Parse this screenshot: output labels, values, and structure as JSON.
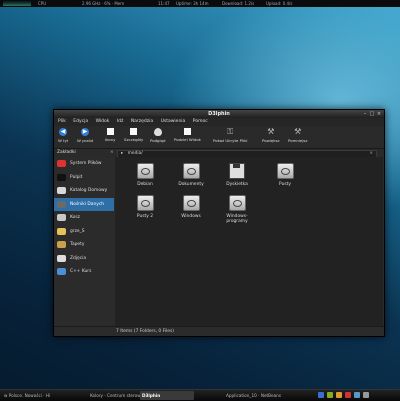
{
  "top_panel": {
    "cpu": "CPU",
    "mem": "2.96 GHz · 6% · Mem",
    "clock": "11:47",
    "uptime": "Uptime: 3h 14m",
    "download": "Download: 1.2/s",
    "upload": "Upload: 0.4/s"
  },
  "window": {
    "title": "D3lphin",
    "controls": {
      "minimize": "–",
      "maximize": "□",
      "close": "×"
    }
  },
  "menu": [
    "Plik",
    "Edycja",
    "Widok",
    "Idź",
    "Narzędzia",
    "Ustawienia",
    "Pomoc"
  ],
  "toolbar": [
    {
      "label": "W tył",
      "icon": "back-arrow-icon"
    },
    {
      "label": "W przód",
      "icon": "forward-arrow-icon"
    },
    {
      "label": "Ikony",
      "icon": "icons-view-icon"
    },
    {
      "label": "Szczegóły",
      "icon": "details-view-icon"
    },
    {
      "label": "Podgląd",
      "icon": "preview-icon"
    },
    {
      "label": "Podziel Widok",
      "icon": "split-view-icon"
    },
    {
      "label": "Pokaż Ukryte Pliki",
      "icon": "hidden-files-icon"
    },
    {
      "label": "Powiększ",
      "icon": "zoom-in-icon"
    },
    {
      "label": "Pomniejsz",
      "icon": "zoom-out-icon"
    }
  ],
  "places_header": "Zakładki",
  "location": "media/",
  "places": [
    {
      "label": "System Plików",
      "color": "#d33",
      "icon": "filesystem-icon",
      "selected": false
    },
    {
      "label": "Pulpit",
      "color": "#111",
      "icon": "desktop-icon",
      "selected": false
    },
    {
      "label": "Katalog Domowy",
      "color": "#d8d8d8",
      "icon": "home-folder-icon",
      "selected": false
    },
    {
      "label": "Nośniki Danych",
      "color": "#6a6a6a",
      "icon": "storage-media-icon",
      "selected": true
    },
    {
      "label": "Kosz",
      "color": "#c9c9c9",
      "icon": "trash-icon",
      "selected": false
    },
    {
      "label": "grze_S",
      "color": "#e6c15a",
      "icon": "star-folder-icon",
      "selected": false
    },
    {
      "label": "Tapety",
      "color": "#caa14a",
      "icon": "wallpaper-folder-icon",
      "selected": false
    },
    {
      "label": "Zdjęcia",
      "color": "#ddd",
      "icon": "photos-folder-icon",
      "selected": false
    },
    {
      "label": "C++ Kurs",
      "color": "#4a8fd8",
      "icon": "network-folder-icon",
      "selected": false
    }
  ],
  "items": [
    {
      "label": "Debian",
      "kind": "drive"
    },
    {
      "label": "Dokumenty",
      "kind": "drive"
    },
    {
      "label": "Dyskietka",
      "kind": "floppy"
    },
    {
      "label": "Pusty",
      "kind": "drive"
    },
    {
      "label": "Pusty 2",
      "kind": "drive"
    },
    {
      "label": "Windows",
      "kind": "drive"
    },
    {
      "label": "Windows-programy",
      "kind": "drive"
    }
  ],
  "status": "7 Items (7 Folders, 0 Files)",
  "taskbar": {
    "tasks": [
      {
        "label": "w Polsce. Nowości · Hi",
        "active": false
      },
      {
        "label": "Kolory · Centrum sterowa",
        "active": false
      },
      {
        "label": "D3lphin",
        "active": true
      },
      {
        "label": "Application_10 · NetBeans",
        "active": false
      }
    ],
    "tray_colors": [
      "#3b6ed1",
      "#8a2",
      "#d93",
      "#c33",
      "#59c",
      "#999"
    ]
  }
}
